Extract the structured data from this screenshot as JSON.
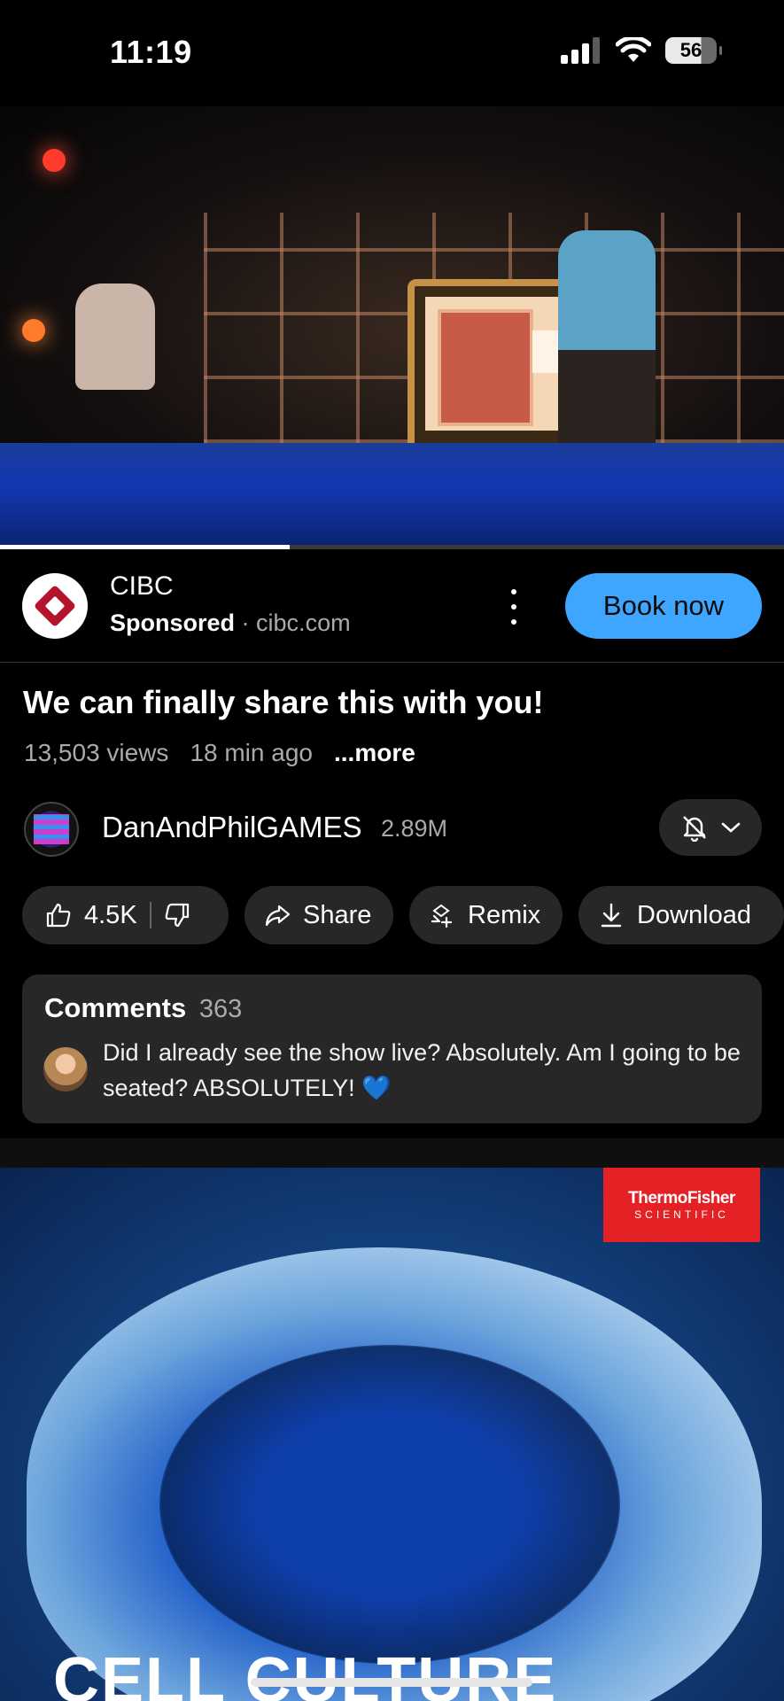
{
  "status_bar": {
    "time": "11:19",
    "battery": "56"
  },
  "video": {
    "progress": 0.37
  },
  "ad": {
    "advertiser": "CIBC",
    "sponsored_label": "Sponsored",
    "separator": "·",
    "domain": "cibc.com",
    "cta_label": "Book now"
  },
  "video_info": {
    "title": "We can finally share this with you!",
    "views": "13,503 views",
    "age": "18 min ago",
    "more_label": "...more"
  },
  "channel": {
    "name": "DanAndPhilGAMES",
    "subscribers": "2.89M"
  },
  "actions": {
    "likes": "4.5K",
    "share": "Share",
    "remix": "Remix",
    "download": "Download"
  },
  "comments": {
    "title": "Comments",
    "count": "363",
    "top_comment": "Did I already see the show live? Absolutely. Am I going to be seated? ABSOLUTELY! 💙"
  },
  "next_ad": {
    "brand_line1": "ThermoFisher",
    "brand_line2": "SCIENTIFIC",
    "overlay_text": "CELL CULTURE"
  },
  "colors": {
    "accent_blue": "#3ea6ff",
    "cibc_red": "#b5122b",
    "thermo_red": "#e42226",
    "pill_bg": "#272727"
  }
}
